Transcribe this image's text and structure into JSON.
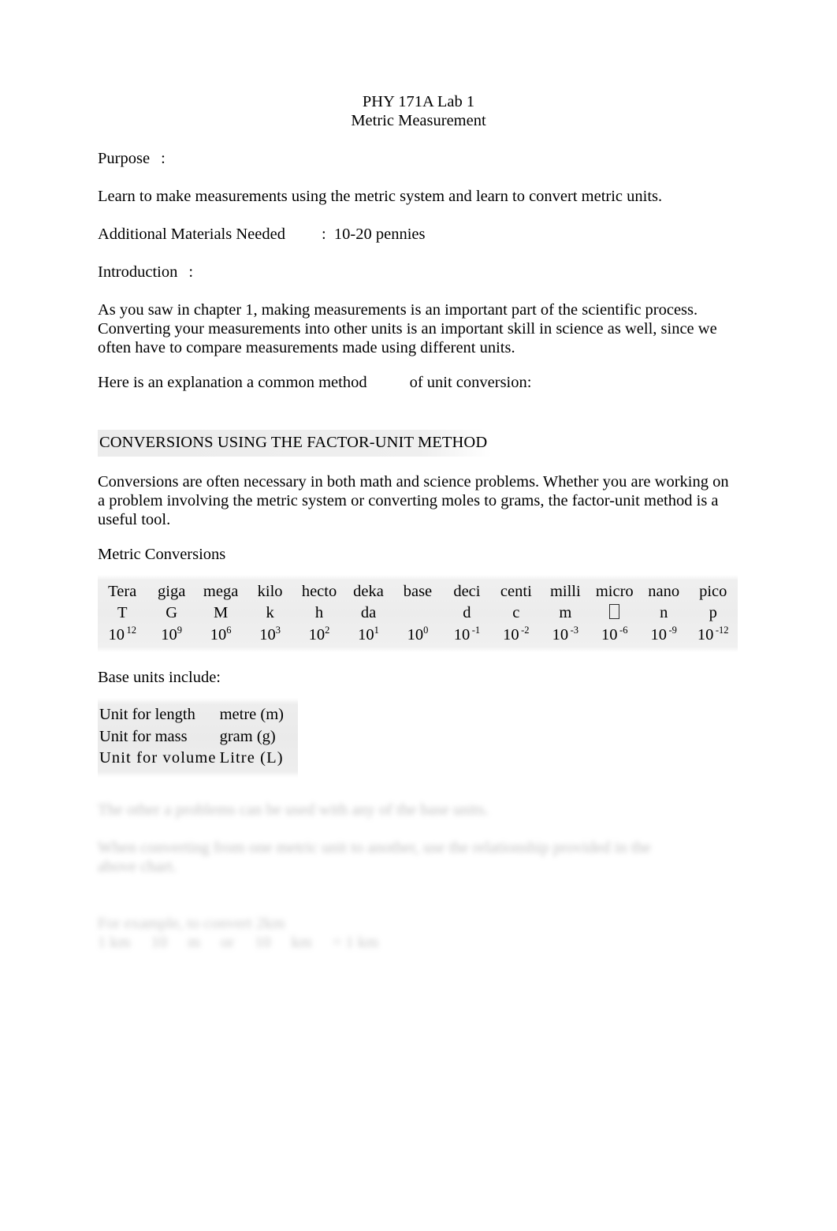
{
  "document": {
    "title_lines": [
      "PHY 171A Lab 1",
      "Metric Measurement"
    ],
    "sections": {
      "purpose_label": "Purpose",
      "purpose_colon": ":",
      "purpose_text": "Learn to make measurements using the metric system and learn to convert metric units.",
      "materials_label": "Additional Materials Needed",
      "materials_colon": ":",
      "materials_value": "10-20 pennies",
      "introduction_label": "Introduction",
      "introduction_colon": ":",
      "introduction_text": "As you saw in chapter 1, making measurements is an important part of the scientific process.    Converting your measurements into other units is an important skill in science as well, since we often have to compare measurements made using different units.",
      "explanation_text_before": "Here is an explanation a common method",
      "explanation_text_after": "of unit conversion:",
      "conversions_heading": "CONVERSIONS USING THE FACTOR-UNIT METHOD",
      "conversions_paragraph": "Conversions are often necessary in both math and science problems. Whether you are working on a problem involving the metric system or converting moles to grams, the factor-unit method is a useful tool.",
      "metric_conversions_label": "Metric Conversions",
      "base_units_label": "Base units include:"
    }
  },
  "metric_table": {
    "prefixes": [
      "Tera",
      "giga",
      "mega",
      "kilo",
      "hecto",
      "deka",
      "base",
      "deci",
      "centi",
      "milli",
      "micro",
      "nano",
      "pico"
    ],
    "symbols": [
      "T",
      "G",
      "M",
      "k",
      "h",
      "da",
      "",
      "d",
      "c",
      "m",
      "▯",
      "n",
      "p"
    ],
    "powers_base": [
      "10",
      "10",
      "10",
      "10",
      "10",
      "10",
      "10",
      "10",
      "10",
      "10",
      "10",
      "10",
      "10"
    ],
    "powers_exponent": [
      "12",
      "9",
      "6",
      "3",
      "2",
      "1",
      "0",
      "-1",
      "-2",
      "-3",
      "-6",
      "-9",
      "-12"
    ]
  },
  "base_units_table": {
    "rows": [
      {
        "label": "Unit for length",
        "value": "metre (m)"
      },
      {
        "label": "Unit for mass",
        "value": "gram (g)"
      },
      {
        "label": "Unit for volume",
        "value": "Litre (L)"
      }
    ]
  },
  "obscured_text": {
    "note": "blurred illegible body text",
    "line1": "The other a problems can be used with any of the base units.",
    "line2a": "When converting from one metric unit to another, use the relationship provided in the",
    "line2b": "above chart.",
    "line3": "For example, to convert 2km",
    "line4_tokens": [
      "1 km",
      "10",
      "m",
      "or",
      "10",
      "km",
      "= 1 km"
    ]
  }
}
